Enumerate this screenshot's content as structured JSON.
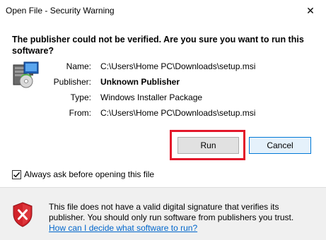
{
  "window": {
    "title": "Open File - Security Warning",
    "close_glyph": "✕"
  },
  "heading": "The publisher could not be verified.  Are you sure you want to run this software?",
  "details": [
    {
      "label": "Name:",
      "value": "C:\\Users\\Home PC\\Downloads\\setup.msi"
    },
    {
      "label": "Publisher:",
      "value": "Unknown Publisher"
    },
    {
      "label": "Type:",
      "value": "Windows Installer Package"
    },
    {
      "label": "From:",
      "value": "C:\\Users\\Home PC\\Downloads\\setup.msi"
    }
  ],
  "buttons": {
    "run": "Run",
    "cancel": "Cancel"
  },
  "checkbox": {
    "label": "Always ask before opening this file",
    "checked": true
  },
  "footer": {
    "warning_line1": "This file does not have a valid digital signature that verifies its",
    "warning_line2": "publisher.  You should only run software from publishers you trust.",
    "link": "How can I decide what software to run?"
  },
  "colors": {
    "highlight": "#e3172a",
    "link": "#0066cc",
    "default_button_border": "#0078d7",
    "shield_red": "#d1232a"
  },
  "icons": {
    "app": "installer-package-icon",
    "footer": "shield-error-icon"
  }
}
